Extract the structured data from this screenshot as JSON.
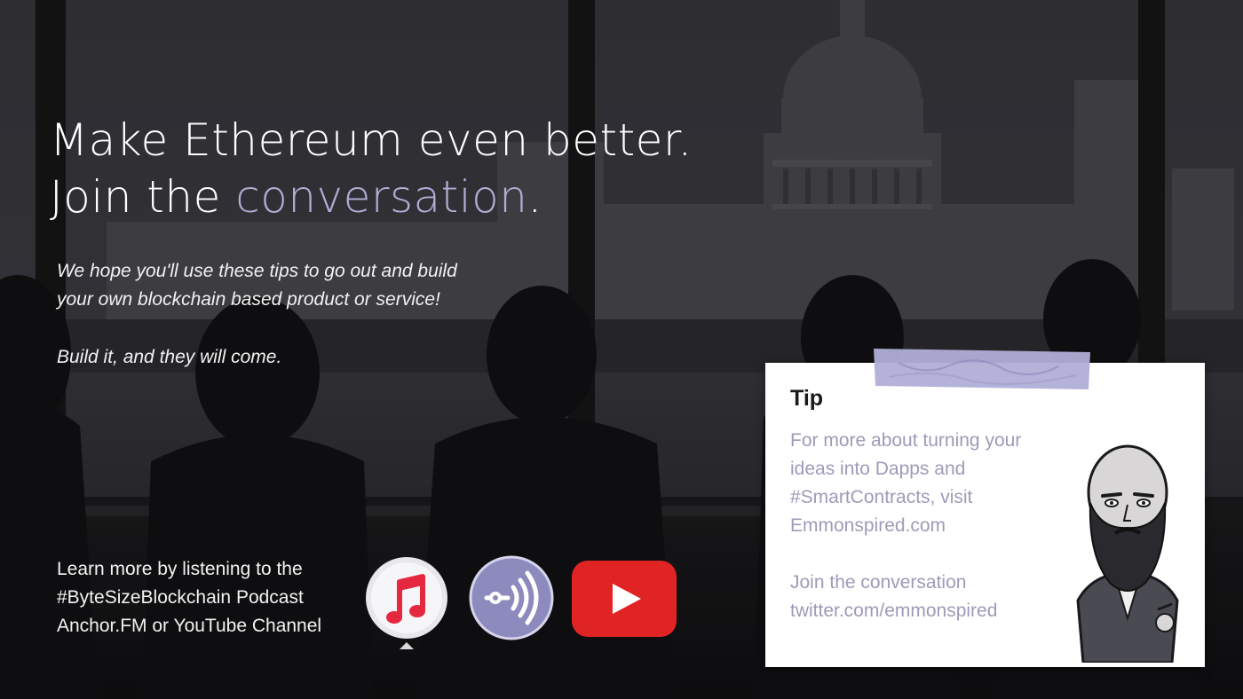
{
  "headline": {
    "line1": "Make Ethereum even better.",
    "line2_prefix": "Join the ",
    "line2_accent": "conversation",
    "line2_suffix": "."
  },
  "intro": {
    "line1": "We hope you'll use these tips to go out and build",
    "line2": "your own blockchain based product or service!",
    "line3": "Build it, and they will come."
  },
  "learn_more": {
    "line1": "Learn more by listening to the",
    "line2": "#ByteSizeBlockchain Podcast",
    "line3": "Anchor.FM or YouTube Channel"
  },
  "icons": [
    "apple-podcasts-music-icon",
    "anchor-fm-icon",
    "youtube-icon"
  ],
  "tip_card": {
    "title": "Tip",
    "line1": "For more about turning your",
    "line2": "ideas into Dapps and",
    "line3": "#SmartContracts, visit",
    "line4": "Emmonspired.com",
    "line5": "Join the conversation",
    "line6": "twitter.com/emmonspired"
  },
  "colors": {
    "accent": "#b0aed6",
    "tip_text": "#9d9bb8",
    "youtube_red": "#e02424",
    "apple_red": "#e5283f",
    "anchor_purple": "#8d8bbd"
  }
}
